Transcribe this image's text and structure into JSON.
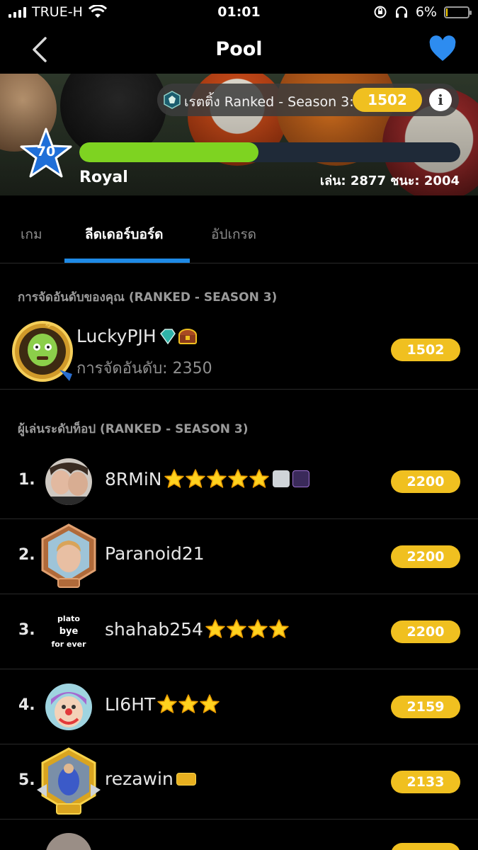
{
  "status_bar": {
    "carrier": "TRUE-H",
    "time": "01:01",
    "battery": "6%",
    "battery_level": 0.06
  },
  "nav": {
    "title": "Pool"
  },
  "banner": {
    "rating_label": "เรตติ้ง Ranked - Season 3:",
    "rating_value": "1502",
    "level": "70",
    "xp_progress": 0.47,
    "league": "Royal",
    "stats": "เล่น: 2877 ชนะ: 2004"
  },
  "tabs": [
    {
      "label": "เกม",
      "active": false
    },
    {
      "label": "ลีดเดอร์บอร์ด",
      "active": true
    },
    {
      "label": "อัปเกรด",
      "active": false
    }
  ],
  "my_ranking": {
    "title": "การจัดอันดับของคุณ (RANKED - SEASON 3)",
    "name": "LuckyPJH",
    "rank_text": "การจัดอันดับ: 2350",
    "score": "1502"
  },
  "top_players": {
    "title": "ผู้เล่นระดับท็อป (RANKED - SEASON 3)",
    "avatar_text": [
      "plato",
      "bye",
      "for ever"
    ],
    "rows": [
      {
        "rank": "1.",
        "name": "8RMiN",
        "stars": 5,
        "score": "2200"
      },
      {
        "rank": "2.",
        "name": "Paranoid21",
        "stars": 0,
        "score": "2200"
      },
      {
        "rank": "3.",
        "name": "shahab254",
        "stars": 4,
        "score": "2200"
      },
      {
        "rank": "4.",
        "name": "LI6HT",
        "stars": 3,
        "score": "2159"
      },
      {
        "rank": "5.",
        "name": "rezawin",
        "stars": 0,
        "score": "2133"
      }
    ]
  },
  "colors": {
    "accent_blue": "#1e8ae6",
    "gold": "#f0c020",
    "xp_green": "#7ed321"
  }
}
